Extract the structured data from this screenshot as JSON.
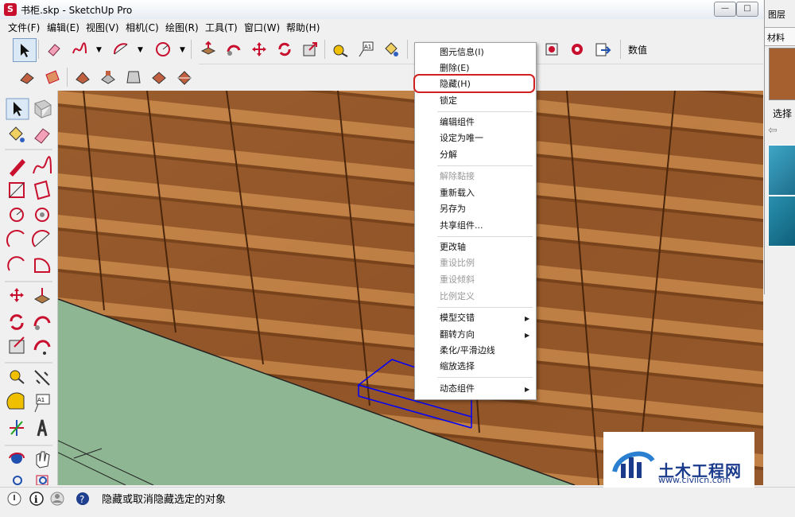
{
  "window": {
    "title": "书柜.skp - SketchUp Pro",
    "buttons": [
      "minimize-button",
      "maximize-button",
      "close-button"
    ]
  },
  "menubar": {
    "items": [
      "文件(F)",
      "编辑(E)",
      "视图(V)",
      "相机(C)",
      "绘图(R)",
      "工具(T)",
      "窗口(W)",
      "帮助(H)"
    ]
  },
  "toolbar": {
    "value_label": "数值",
    "icons": [
      "select-arrow-icon",
      "eraser-icon",
      "freehand-icon",
      "arc-icon",
      "circle-icon",
      "push-pull-icon",
      "follow-me-icon",
      "move-icon",
      "rotate-icon",
      "offset-icon",
      "tape-measure-icon",
      "text-icon",
      "paint-bucket-icon",
      "orbit-icon",
      "pan-icon",
      "zoom-icon",
      "components-icon",
      "warehouse-icon",
      "export-icon"
    ]
  },
  "context_menu": {
    "items": [
      {
        "label": "图元信息(I)",
        "enabled": true
      },
      {
        "label": "删除(E)",
        "enabled": true
      },
      {
        "label": "隐藏(H)",
        "enabled": true,
        "highlighted": true
      },
      {
        "label": "锁定",
        "enabled": true
      },
      {
        "label": "编辑组件",
        "enabled": true
      },
      {
        "label": "设定为唯一",
        "enabled": true
      },
      {
        "label": "分解",
        "enabled": true
      },
      {
        "label": "解除黏接",
        "enabled": false
      },
      {
        "label": "重新载入",
        "enabled": true
      },
      {
        "label": "另存为",
        "enabled": true
      },
      {
        "label": "共享组件...",
        "enabled": true
      },
      {
        "label": "更改轴",
        "enabled": true
      },
      {
        "label": "重设比例",
        "enabled": false
      },
      {
        "label": "重设倾斜",
        "enabled": false
      },
      {
        "label": "比例定义",
        "enabled": false
      },
      {
        "label": "模型交错",
        "enabled": true,
        "submenu": true
      },
      {
        "label": "翻转方向",
        "enabled": true,
        "submenu": true
      },
      {
        "label": "柔化/平滑边线",
        "enabled": true
      },
      {
        "label": "缩放选择",
        "enabled": true
      },
      {
        "label": "动态组件",
        "enabled": true,
        "submenu": true
      }
    ]
  },
  "right_panel": {
    "layers_title": "图层",
    "materials_title": "材料",
    "select_label": "选择"
  },
  "status_bar": {
    "text": "隐藏或取消隐藏选定的对象"
  },
  "watermark": {
    "brand": "土木工程网",
    "url": "www.civilcn.com"
  },
  "colors": {
    "wood": "#9a5a2a",
    "wood_light": "#c98a4d",
    "ground": "#8fb693",
    "highlight_ring": "#d02020",
    "selection_box": "#0000ff"
  }
}
